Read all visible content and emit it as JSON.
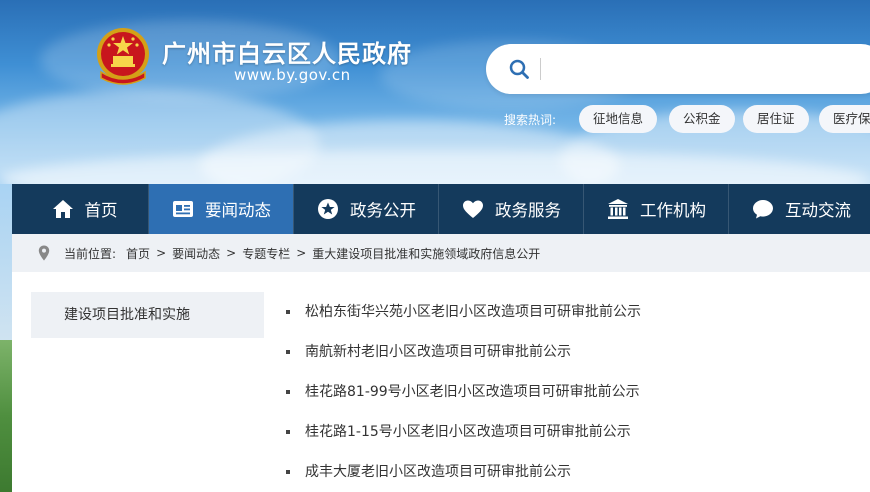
{
  "header": {
    "site_title": "广州市白云区人民政府",
    "site_url": "www.by.gov.cn",
    "emblem_icon": "national-emblem-icon"
  },
  "search": {
    "placeholder": "",
    "value": "",
    "hot_label": "搜索热词:",
    "hot_tags": [
      "征地信息",
      "公积金",
      "居住证",
      "医疗保"
    ]
  },
  "nav": {
    "items": [
      {
        "label": "首页",
        "icon": "home-icon"
      },
      {
        "label": "要闻动态",
        "icon": "news-card-icon"
      },
      {
        "label": "政务公开",
        "icon": "star-circle-icon"
      },
      {
        "label": "政务服务",
        "icon": "heart-icon"
      },
      {
        "label": "工作机构",
        "icon": "institution-icon"
      },
      {
        "label": "互动交流",
        "icon": "chat-bubble-icon"
      }
    ],
    "active_index": 1
  },
  "breadcrumb": {
    "prefix": "当前位置:",
    "items": [
      "首页",
      "要闻动态",
      "专题专栏",
      "重大建设项目批准和实施领域政府信息公开"
    ],
    "separator": ">"
  },
  "sidebar": {
    "items": [
      {
        "label": "建设项目批准和实施"
      }
    ]
  },
  "articles": [
    {
      "title": "松柏东街华兴苑小区老旧小区改造项目可研审批前公示"
    },
    {
      "title": "南航新村老旧小区改造项目可研审批前公示"
    },
    {
      "title": "桂花路81-99号小区老旧小区改造项目可研审批前公示"
    },
    {
      "title": "桂花路1-15号小区老旧小区改造项目可研审批前公示"
    },
    {
      "title": "成丰大厦老旧小区改造项目可研审批前公示"
    }
  ],
  "colors": {
    "nav_bg": "#143a5c",
    "nav_active": "#2e6fb3",
    "banner_blue": "#3f8fd4",
    "crumb_bg": "#eef1f5"
  }
}
